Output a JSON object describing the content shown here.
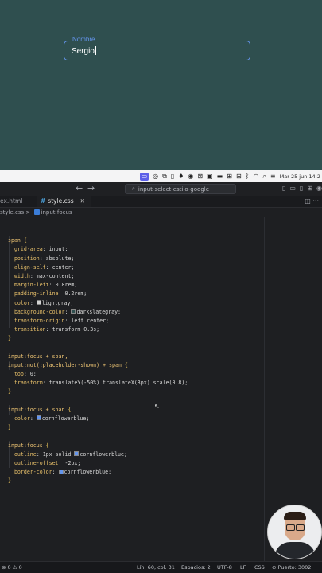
{
  "preview": {
    "field_label": "Nombre",
    "field_value": "Sergio"
  },
  "menubar": {
    "icons": [
      "screen-record-icon",
      "layers-icon",
      "copy-icon",
      "battery-icon",
      "flame-icon",
      "grid-icon",
      "app-icon",
      "wifi-extra-icon",
      "bluetooth-icon",
      "wifi-icon",
      "search-icon",
      "control-center-icon"
    ],
    "datetime": "Mar 25 jun 14:2"
  },
  "titlebar": {
    "search_text": "input-select-estilo-google"
  },
  "tabs": [
    {
      "label": "ex.html",
      "active": false
    },
    {
      "label": "style.css",
      "active": true
    }
  ],
  "breadcrumb": {
    "file": "style.css",
    "separator": ">",
    "symbol": "input:focus"
  },
  "code": {
    "lines": [
      "",
      "span {",
      "  grid-area: input;",
      "  position: absolute;",
      "  align-self: center;",
      "  width: max-content;",
      "  margin-left: 0.8rem;",
      "  padding-inline: 0.2rem;",
      "  color: lightgray;",
      "  background-color: darkslategray;",
      "  transform-origin: left center;",
      "  transition: transform 0.3s;",
      "}",
      "",
      "input:focus + span,",
      "input:not(:placeholder-shown) + span {",
      "  top: 0;",
      "  transform: translateY(-50%) translateX(3px) scale(0.8);",
      "}",
      "",
      "input:focus + span {",
      "  color: cornflowerblue;",
      "}",
      "",
      "input:focus {",
      "  outline: 1px solid cornflowerblue;",
      "  outline-offset: -2px;",
      "  border-color: cornflowerblue;",
      "}"
    ]
  },
  "colors": {
    "lightgray": "#d3d3d3",
    "darkslategray": "#2f4f4f",
    "cornflowerblue": "#6495ed"
  },
  "statusbar": {
    "errors": "0",
    "warnings": "0",
    "position": "Lín. 60, col. 31",
    "spaces": "Espacios: 2",
    "encoding": "UTF-8",
    "eol": "LF",
    "language": "CSS",
    "port": "Puerto: 3002"
  }
}
